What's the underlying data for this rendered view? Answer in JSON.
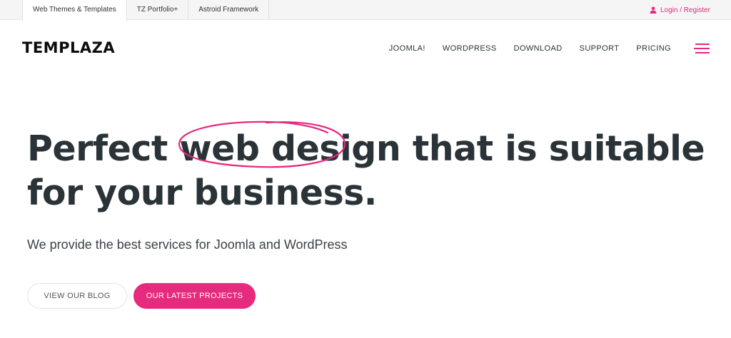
{
  "topbar": {
    "tabs": [
      {
        "label": "Web Themes & Templates",
        "active": true
      },
      {
        "label": "TZ Portfolio+",
        "active": false
      },
      {
        "label": "Astroid Framework",
        "active": false
      }
    ],
    "login_label": "Login / Register",
    "login_icon": "user-icon"
  },
  "header": {
    "logo": "TEMPLAZA",
    "nav": [
      "JOOMLA!",
      "WORDPRESS",
      "DOWNLOAD",
      "SUPPORT",
      "PRICING"
    ],
    "menu_icon": "hamburger-menu-icon"
  },
  "hero": {
    "title_before": "Perfect ",
    "title_highlight": "web design",
    "title_after": " that is suitable for your business.",
    "subtitle": "We provide the best services for Joomla and WordPress",
    "btn_blog": "VIEW OUR BLOG",
    "btn_projects": "OUR LATEST PROJECTS"
  },
  "colors": {
    "accent": "#e62a7d",
    "text": "#2a3337",
    "topbar_bg": "#f5f5f5"
  }
}
